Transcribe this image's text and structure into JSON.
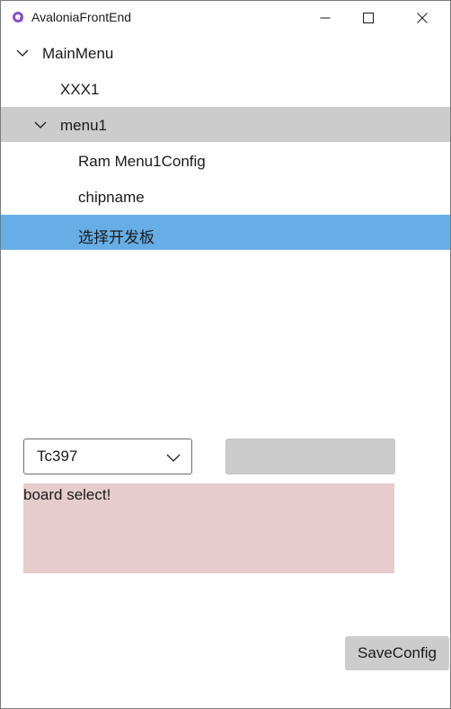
{
  "window": {
    "title": "AvaloniaFrontEnd",
    "icon": "avalonia-logo-icon",
    "controls": [
      "minimize-icon",
      "maximize-icon",
      "close-icon"
    ]
  },
  "tree": {
    "root": {
      "label": "MainMenu",
      "expanded": true
    },
    "items": [
      {
        "label": "XXX1"
      },
      {
        "label": "menu1",
        "expanded": true,
        "highlighted": true
      },
      {
        "label": "Ram Menu1Config"
      },
      {
        "label": "chipname"
      },
      {
        "label": "选择开发板",
        "selected": true
      }
    ]
  },
  "board_select": {
    "value": "Tc397",
    "status_text": "board select!"
  },
  "actions": {
    "save_label": "SaveConfig"
  },
  "colors": {
    "selection": "#67aee6",
    "highlight": "#cccccc",
    "status_bg": "#e6cccc",
    "accent_icon": "#8b4fc8"
  }
}
